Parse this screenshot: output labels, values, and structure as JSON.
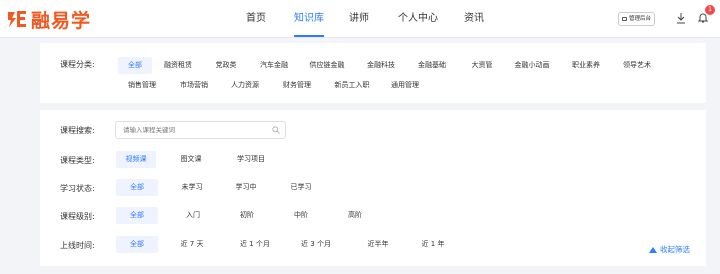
{
  "brand": {
    "name": "融易学",
    "color": "#f05a22"
  },
  "nav": [
    "首页",
    "知识库",
    "讲师",
    "个人中心",
    "资讯"
  ],
  "nav_active": "知识库",
  "header": {
    "admin_label": "管理后台",
    "notification_count": "1"
  },
  "category": {
    "label": "课程分类:",
    "options": [
      "全部",
      "融资租赁",
      "党政类",
      "汽车金融",
      "供应链金融",
      "金融科技",
      "金融基础",
      "大资管",
      "金融小动画",
      "职业素养",
      "领导艺术",
      "销售管理",
      "市场营销",
      "人力资源",
      "财务管理",
      "新员工入职",
      "通用管理"
    ],
    "selected": "全部"
  },
  "search": {
    "label": "课程搜索:",
    "placeholder": "请输入课程关键词"
  },
  "type": {
    "label": "课程类型:",
    "options": [
      "视频课",
      "图文课",
      "学习项目"
    ],
    "selected": "视频课"
  },
  "status": {
    "label": "学习状态:",
    "options": [
      "全部",
      "未学习",
      "学习中",
      "已学习"
    ],
    "selected": "全部"
  },
  "level": {
    "label": "课程级别:",
    "options": [
      "全部",
      "入门",
      "初阶",
      "中阶",
      "高阶"
    ],
    "selected": "全部"
  },
  "time": {
    "label": "上线时间:",
    "options": [
      "全部",
      "近 7 天",
      "近 1 个月",
      "近 3 个月",
      "近半年",
      "近 1 年"
    ],
    "selected": "全部"
  },
  "collapse_label": "收起筛选",
  "accent_color": "#2f7bff"
}
